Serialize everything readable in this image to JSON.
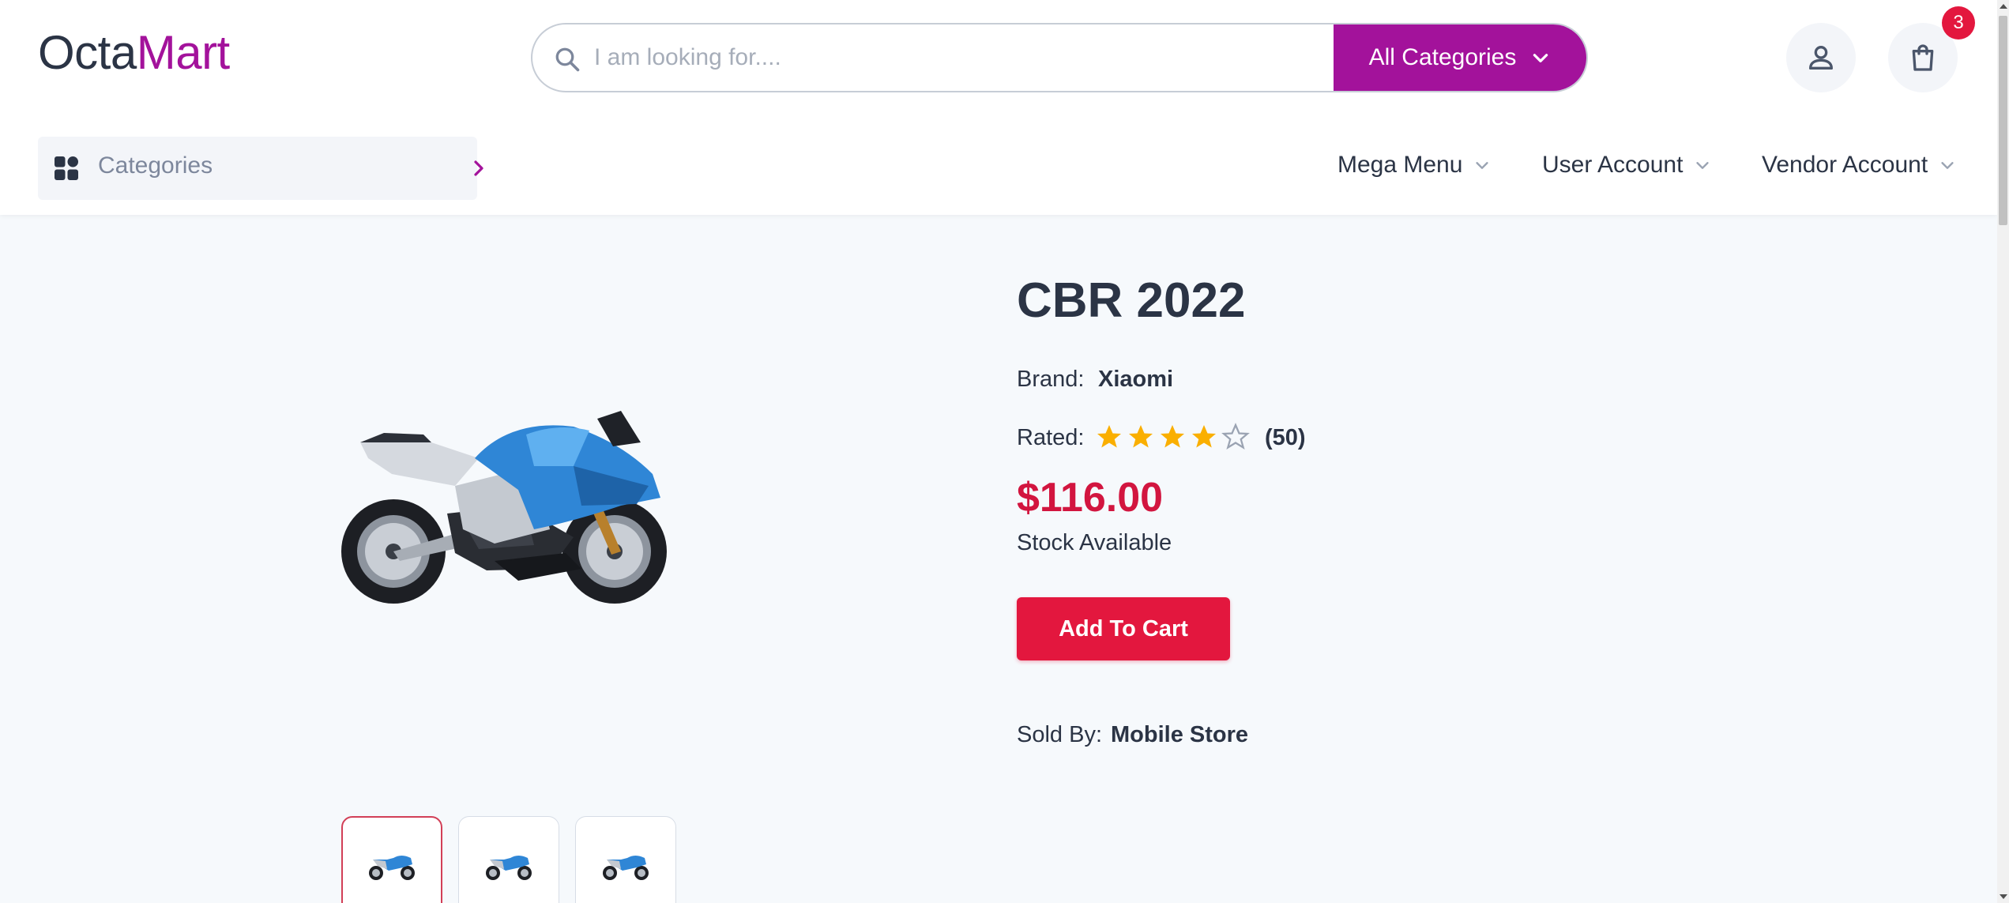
{
  "brand": {
    "part1": "Octa",
    "part2": "Mart"
  },
  "search": {
    "placeholder": "I am looking for....",
    "category_button": "All Categories"
  },
  "cart": {
    "count": "3"
  },
  "nav": {
    "categories_label": "Categories",
    "menus": [
      "Mega Menu",
      "User Account",
      "Vendor Account"
    ]
  },
  "product": {
    "title": "CBR 2022",
    "brand_label": "Brand:",
    "brand_value": "Xiaomi",
    "rated_label": "Rated:",
    "rating": 4,
    "rating_max": 5,
    "review_count": "(50)",
    "price": "$116.00",
    "stock": "Stock Available",
    "add_to_cart": "Add To Cart",
    "sold_by_label": "Sold By:",
    "sold_by_value": "Mobile Store",
    "thumbnail_count": 3
  },
  "colors": {
    "accent": "#a3129b",
    "primary_red": "#e3173e",
    "price_red": "#d2153f",
    "star": "#faaf00",
    "text": "#2b3445"
  },
  "icons": {
    "search": "search-icon",
    "chevron_down": "chevron-down-icon",
    "user": "user-icon",
    "bag": "shopping-bag-icon",
    "grid": "grid-icon",
    "chevron_right": "chevron-right-icon",
    "star": "star-icon"
  }
}
